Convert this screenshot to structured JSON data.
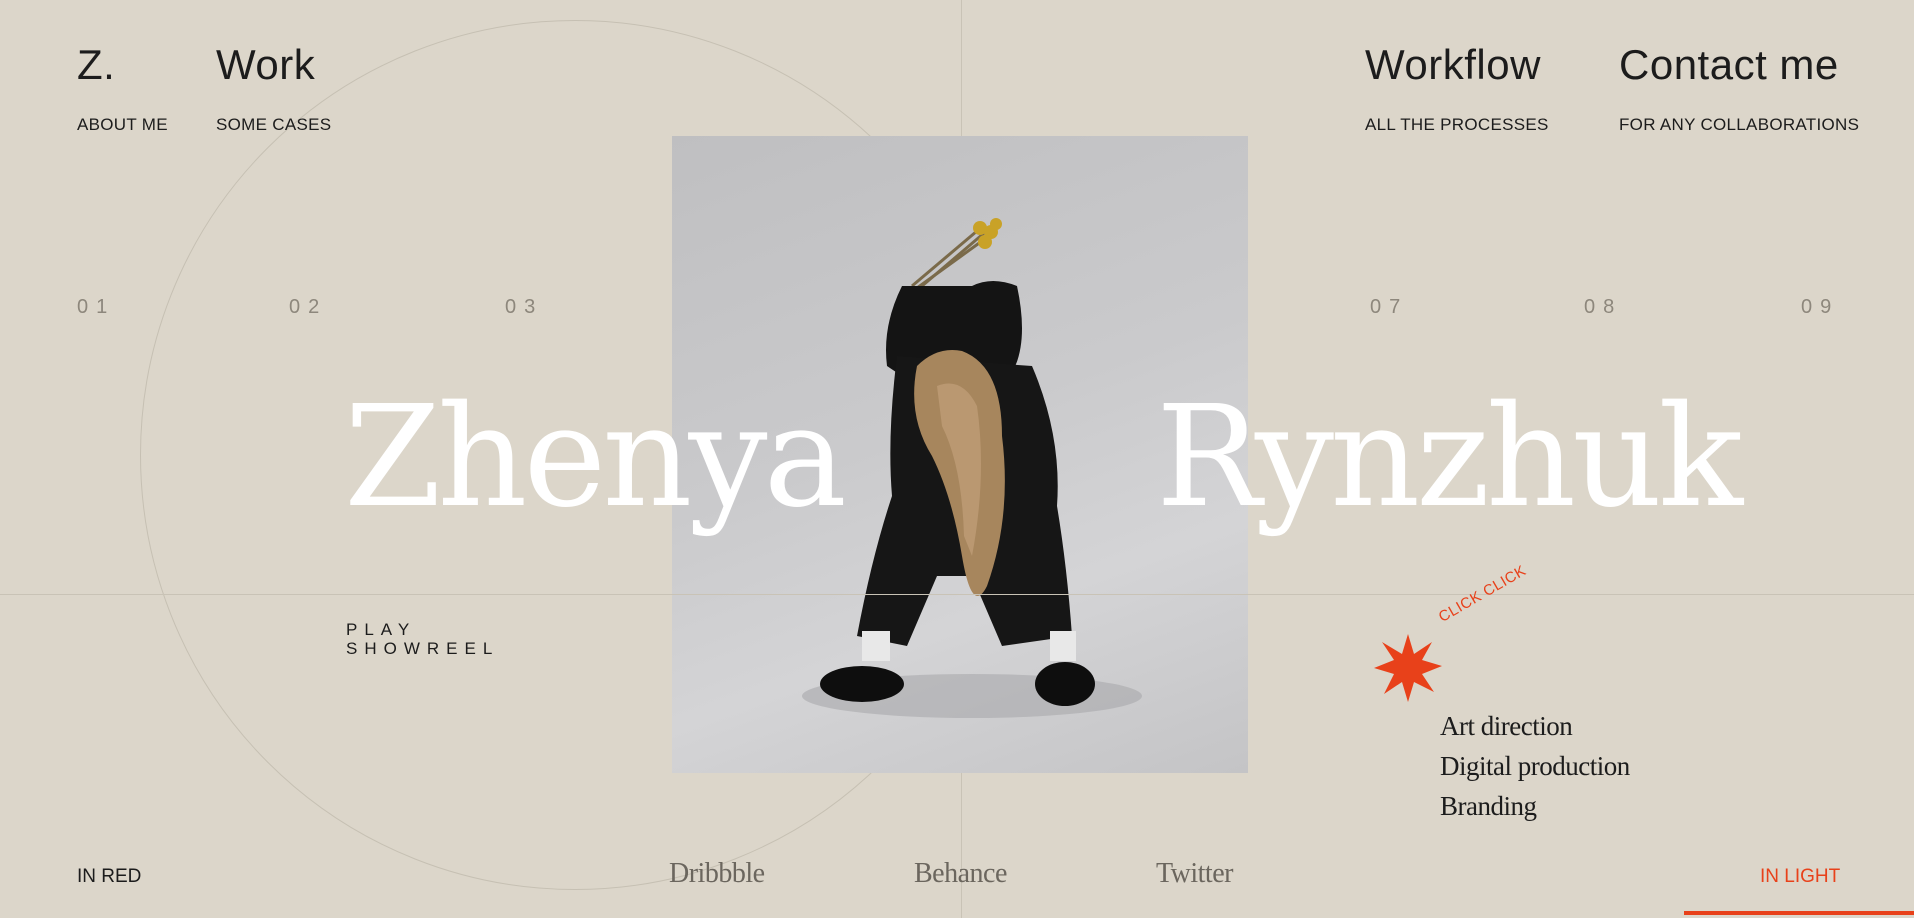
{
  "colors": {
    "background": "#dcd6ca",
    "accent": "#e8411a",
    "text": "#1c1c1c",
    "muted": "#8d877c"
  },
  "header": {
    "logo": {
      "title": "Z.",
      "sub": "ABOUT ME"
    },
    "work": {
      "title": "Work",
      "sub": "SOME CASES"
    },
    "workflow": {
      "title": "Workflow",
      "sub": "ALL THE PROCESSES"
    },
    "contact": {
      "title": "Contact me",
      "sub": "FOR ANY COLLABORATIONS"
    }
  },
  "numbers": [
    "01",
    "02",
    "03",
    "07",
    "08",
    "09"
  ],
  "hero": {
    "first_name": "Zhenya",
    "last_name": "Rynzhuk"
  },
  "showreel": {
    "line1": "PLAY",
    "line2": "SHOWREEL"
  },
  "badge": {
    "label": "CLICK CLICK",
    "icon": "star-burst-icon"
  },
  "services": [
    "Art direction",
    "Digital production",
    "Branding"
  ],
  "footer": {
    "left": "IN RED",
    "social": [
      "Dribbble",
      "Behance",
      "Twitter"
    ],
    "right": "IN LIGHT"
  }
}
